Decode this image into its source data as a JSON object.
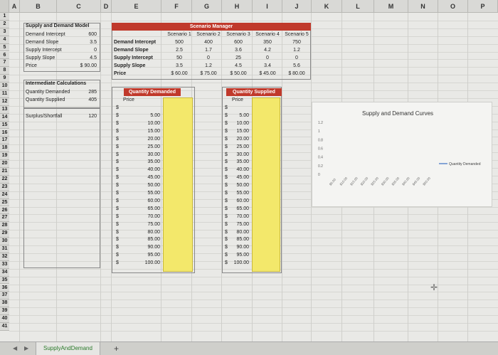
{
  "columns": [
    "A",
    "B",
    "C",
    "D",
    "E",
    "F",
    "G",
    "H",
    "I",
    "J",
    "K",
    "L",
    "M",
    "N",
    "O",
    "P"
  ],
  "rows": [
    "1",
    "2",
    "3",
    "4",
    "5",
    "6",
    "7",
    "8",
    "9",
    "10",
    "11",
    "12",
    "13",
    "14",
    "15",
    "16",
    "17",
    "18",
    "19",
    "20",
    "21",
    "22",
    "23",
    "24",
    "25",
    "26",
    "27",
    "28",
    "29",
    "30",
    "31",
    "32",
    "33",
    "34",
    "35",
    "36",
    "37",
    "38",
    "39",
    "40",
    "41"
  ],
  "model": {
    "title": "Supply and Demand Model",
    "items": [
      {
        "label": "Demand Intercept",
        "value": "600"
      },
      {
        "label": "Demand Slope",
        "value": "3.5"
      },
      {
        "label": "Supply Intercept",
        "value": "0"
      },
      {
        "label": "Supply Slope",
        "value": "4.5"
      },
      {
        "label": "Price",
        "value": "$ 90.00"
      }
    ]
  },
  "intermediate": {
    "title": "Intermediate Calculations",
    "items": [
      {
        "label": "Quantity Demanded",
        "value": "285"
      },
      {
        "label": "Quantity Supplied",
        "value": "405"
      }
    ],
    "surplus_label": "Surplus/Shortfall",
    "surplus_value": "120"
  },
  "scenario": {
    "title": "Scenario Manager",
    "headers": [
      "Scenario 1",
      "Scenario 2",
      "Scenario 3",
      "Scenario 4",
      "Scenario 5"
    ],
    "rows": [
      {
        "label": "Demand Intercept",
        "values": [
          "500",
          "400",
          "600",
          "350",
          "750"
        ]
      },
      {
        "label": "Demand Slope",
        "values": [
          "2.5",
          "1.7",
          "3.6",
          "4.2",
          "1.2"
        ]
      },
      {
        "label": "Supply Intercept",
        "values": [
          "50",
          "0",
          "25",
          "0",
          "0"
        ]
      },
      {
        "label": "Supply Slope",
        "values": [
          "3.5",
          "1.2",
          "4.5",
          "3.4",
          "5.6"
        ]
      },
      {
        "label": "Price",
        "values": [
          "$ 60.00",
          "$ 75.00",
          "$ 50.00",
          "$ 45.00",
          "$ 80.00"
        ]
      }
    ]
  },
  "qd_table": {
    "title": "Quantity Demanded",
    "subheader": "Price",
    "currency": "$",
    "prices": [
      "5.00",
      "10.00",
      "15.00",
      "20.00",
      "25.00",
      "30.00",
      "35.00",
      "40.00",
      "45.00",
      "50.00",
      "55.00",
      "60.00",
      "65.00",
      "70.00",
      "75.00",
      "80.00",
      "85.00",
      "90.00",
      "95.00",
      "100.00"
    ]
  },
  "qs_table": {
    "title": "Quantity Supplied",
    "subheader": "Price",
    "currency": "$",
    "prices": [
      "5.00",
      "10.00",
      "15.00",
      "20.00",
      "25.00",
      "30.00",
      "35.00",
      "40.00",
      "45.00",
      "50.00",
      "55.00",
      "60.00",
      "65.00",
      "70.00",
      "75.00",
      "80.00",
      "85.00",
      "90.00",
      "95.00",
      "100.00"
    ]
  },
  "chart_data": {
    "type": "line",
    "title": "Supply and Demand Curves",
    "y_ticks": [
      "1.2",
      "1",
      "0.8",
      "0.6",
      "0.4",
      "0.2",
      "0"
    ],
    "ylim": [
      0,
      1.2
    ],
    "categories": [
      "$5.00",
      "$10.00",
      "$15.00",
      "$20.00",
      "$25.00",
      "$30.00",
      "$35.00",
      "$40.00",
      "$45.00",
      "$50.00"
    ],
    "series": [
      {
        "name": "Quantity Demanded",
        "values": []
      }
    ],
    "legend_position": "right",
    "colors": {
      "series": "#3b6fc2"
    }
  },
  "sheet_tab": "SupplyAndDemand",
  "add_sheet_label": "+",
  "nav": {
    "prev": "◀",
    "next": "▶"
  }
}
